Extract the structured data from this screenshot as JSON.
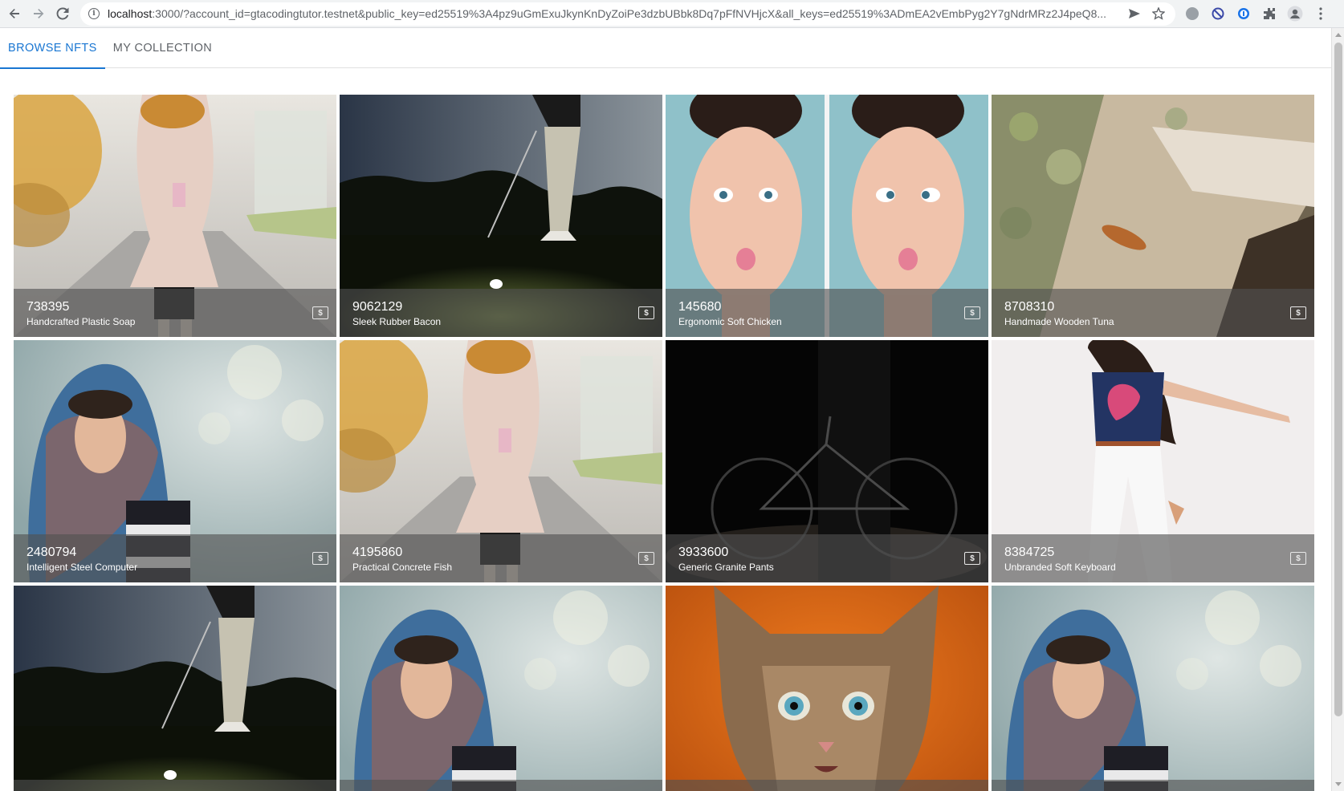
{
  "browser": {
    "url_host": "localhost",
    "url_rest": ":3000/?account_id=gtacodingtutor.testnet&public_key=ed25519%3A4pz9uGmExuJkynKnDyZoiPe3dzbUBbk8Dq7pFfNVHjcX&all_keys=ed25519%3ADmEA2vEmbPyg2Y7gNdrMRz2J4peQ8..."
  },
  "tabs": [
    {
      "label": "BROWSE NFTS",
      "active": true
    },
    {
      "label": "MY COLLECTION",
      "active": false
    }
  ],
  "buy_icon_glyph": "$",
  "nfts": [
    {
      "price": "738395",
      "name": "Handcrafted Plastic Soap",
      "art": "woman-autumn-coat"
    },
    {
      "price": "9062129",
      "name": "Sleek Rubber Bacon",
      "art": "golfer-night"
    },
    {
      "price": "145680",
      "name": "Ergonomic Soft Chicken",
      "art": "fish-face-portraits"
    },
    {
      "price": "8708310",
      "name": "Handmade Wooden Tuna",
      "art": "lichen-rock"
    },
    {
      "price": "2480794",
      "name": "Intelligent Steel Computer",
      "art": "woman-blue-scarf"
    },
    {
      "price": "4195860",
      "name": "Practical Concrete Fish",
      "art": "woman-autumn-coat"
    },
    {
      "price": "3933600",
      "name": "Generic Granite Pants",
      "art": "bicycle-dark"
    },
    {
      "price": "8384725",
      "name": "Unbranded Soft Keyboard",
      "art": "woman-jumping"
    },
    {
      "price": "",
      "name": "",
      "art": "golfer-night"
    },
    {
      "price": "",
      "name": "",
      "art": "woman-blue-scarf"
    },
    {
      "price": "",
      "name": "",
      "art": "cat-orange"
    },
    {
      "price": "",
      "name": "",
      "art": "woman-blue-scarf"
    }
  ]
}
